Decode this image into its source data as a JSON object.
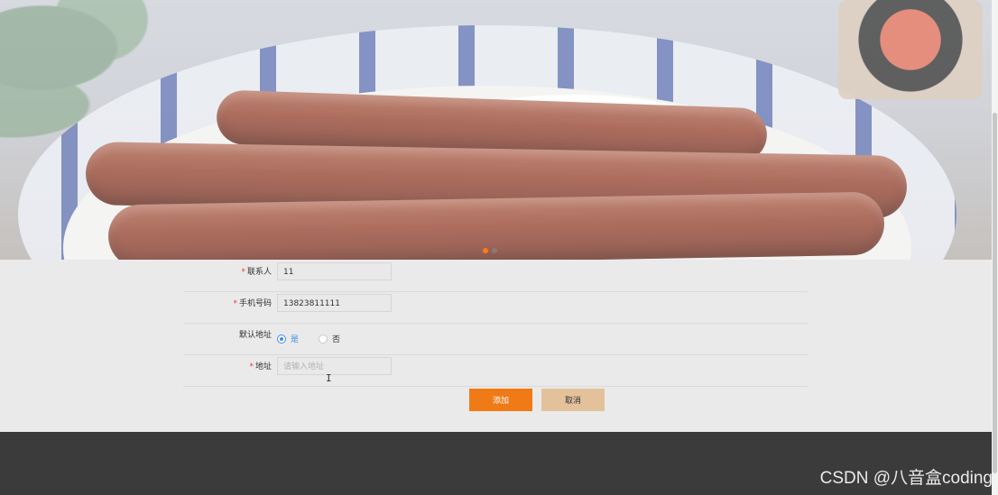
{
  "banner": {
    "dots": [
      {
        "active": true
      },
      {
        "active": false
      }
    ]
  },
  "form": {
    "contact": {
      "label": "联系人",
      "value": "11"
    },
    "phone": {
      "label": "手机号码",
      "value": "13823811111"
    },
    "default_address": {
      "label": "默认地址",
      "options": [
        {
          "label": "是",
          "checked": true
        },
        {
          "label": "否",
          "checked": false
        }
      ]
    },
    "address": {
      "label": "地址",
      "placeholder": "请输入地址",
      "value": ""
    },
    "add_button": "添加",
    "cancel_button": "取消"
  },
  "watermark": "CSDN @八音盒coding",
  "colors": {
    "primary_button": "#f07b16",
    "secondary_button": "#e3c29b",
    "required_mark": "#e23b3b",
    "radio_active": "#3d8ee8",
    "footer": "#3b3b3b"
  }
}
